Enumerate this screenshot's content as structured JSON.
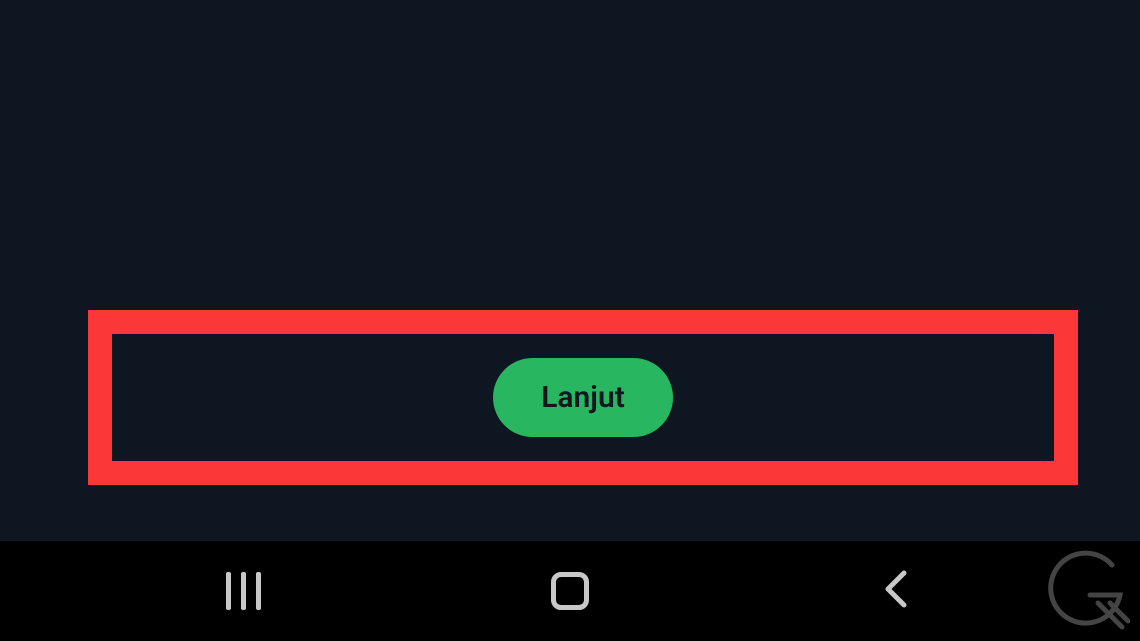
{
  "main": {
    "continue_label": "Lanjut"
  },
  "annotation": {
    "highlight_color": "#fc3737"
  },
  "colors": {
    "button_bg": "#28b661",
    "app_bg": "#0e1621",
    "nav_bg": "#000000",
    "nav_icon": "#c8c8c8"
  },
  "icons": {
    "recents": "recents-icon",
    "home": "home-icon",
    "back": "back-icon",
    "watermark": "logo-icon"
  }
}
